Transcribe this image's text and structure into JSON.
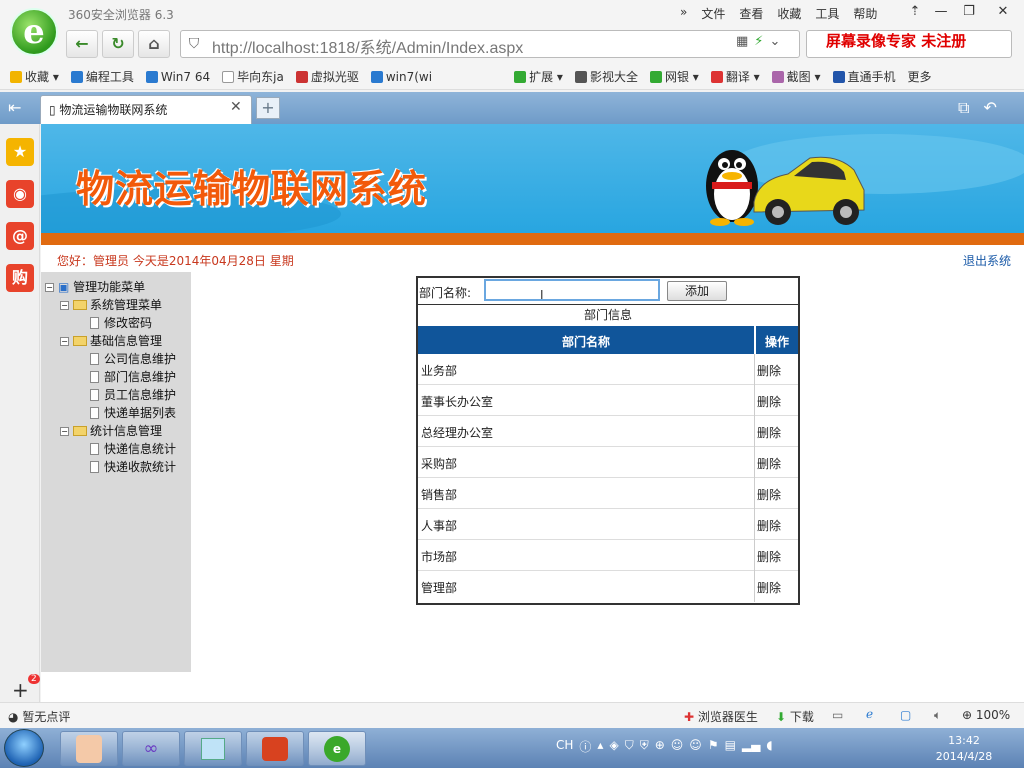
{
  "browser": {
    "app_name": "360安全浏览器 6.3",
    "menus": [
      "»",
      "文件",
      "查看",
      "收藏",
      "工具",
      "帮助"
    ],
    "url": "http://localhost:1818/系统/Admin/Index.aspx",
    "watermark": "屏幕录像专家  未注册",
    "bookmarks": [
      "收藏",
      "编程工具",
      "Win7 64",
      "毕向东ja",
      "虚拟光驱",
      "win7(wi",
      "扩展",
      "影视大全",
      "网银",
      "翻译",
      "截图",
      "直通手机",
      "更多"
    ],
    "tab_title": "物流运输物联网系统"
  },
  "page": {
    "banner_title": "物流运输物联网系统",
    "greeting": "您好：管理员    今天是2014年04月28日    星期",
    "logout": "退出系统"
  },
  "tree": {
    "root": "管理功能菜单",
    "groups": [
      {
        "label": "系统管理菜单",
        "items": [
          "修改密码"
        ]
      },
      {
        "label": "基础信息管理",
        "items": [
          "公司信息维护",
          "部门信息维护",
          "员工信息维护",
          "快递单据列表"
        ]
      },
      {
        "label": "统计信息管理",
        "items": [
          "快递信息统计",
          "快递收款统计"
        ]
      }
    ]
  },
  "form": {
    "label": "部门名称:",
    "input_value": "",
    "add_button": "添加",
    "caption": "部门信息"
  },
  "table": {
    "headers": [
      "部门名称",
      "操作"
    ],
    "rows": [
      {
        "name": "业务部",
        "action": "删除"
      },
      {
        "name": "董事长办公室",
        "action": "删除"
      },
      {
        "name": "总经理办公室",
        "action": "删除"
      },
      {
        "name": "采购部",
        "action": "删除"
      },
      {
        "name": "销售部",
        "action": "删除"
      },
      {
        "name": "人事部",
        "action": "删除"
      },
      {
        "name": "市场部",
        "action": "删除"
      },
      {
        "name": "管理部",
        "action": "删除"
      }
    ]
  },
  "statusbar": {
    "left": "暂无点评",
    "doctor": "浏览器医生",
    "download": "下载",
    "zoom": "100%"
  },
  "taskbar": {
    "ime": "CH",
    "time": "13:42",
    "date": "2014/4/28"
  },
  "left_badge": "2",
  "colors": {
    "banner_bg": "#27a5e0",
    "banner_title": "#f25a0a",
    "table_header": "#10559a",
    "greeting": "#c8381e",
    "link": "#1a5aa8"
  }
}
